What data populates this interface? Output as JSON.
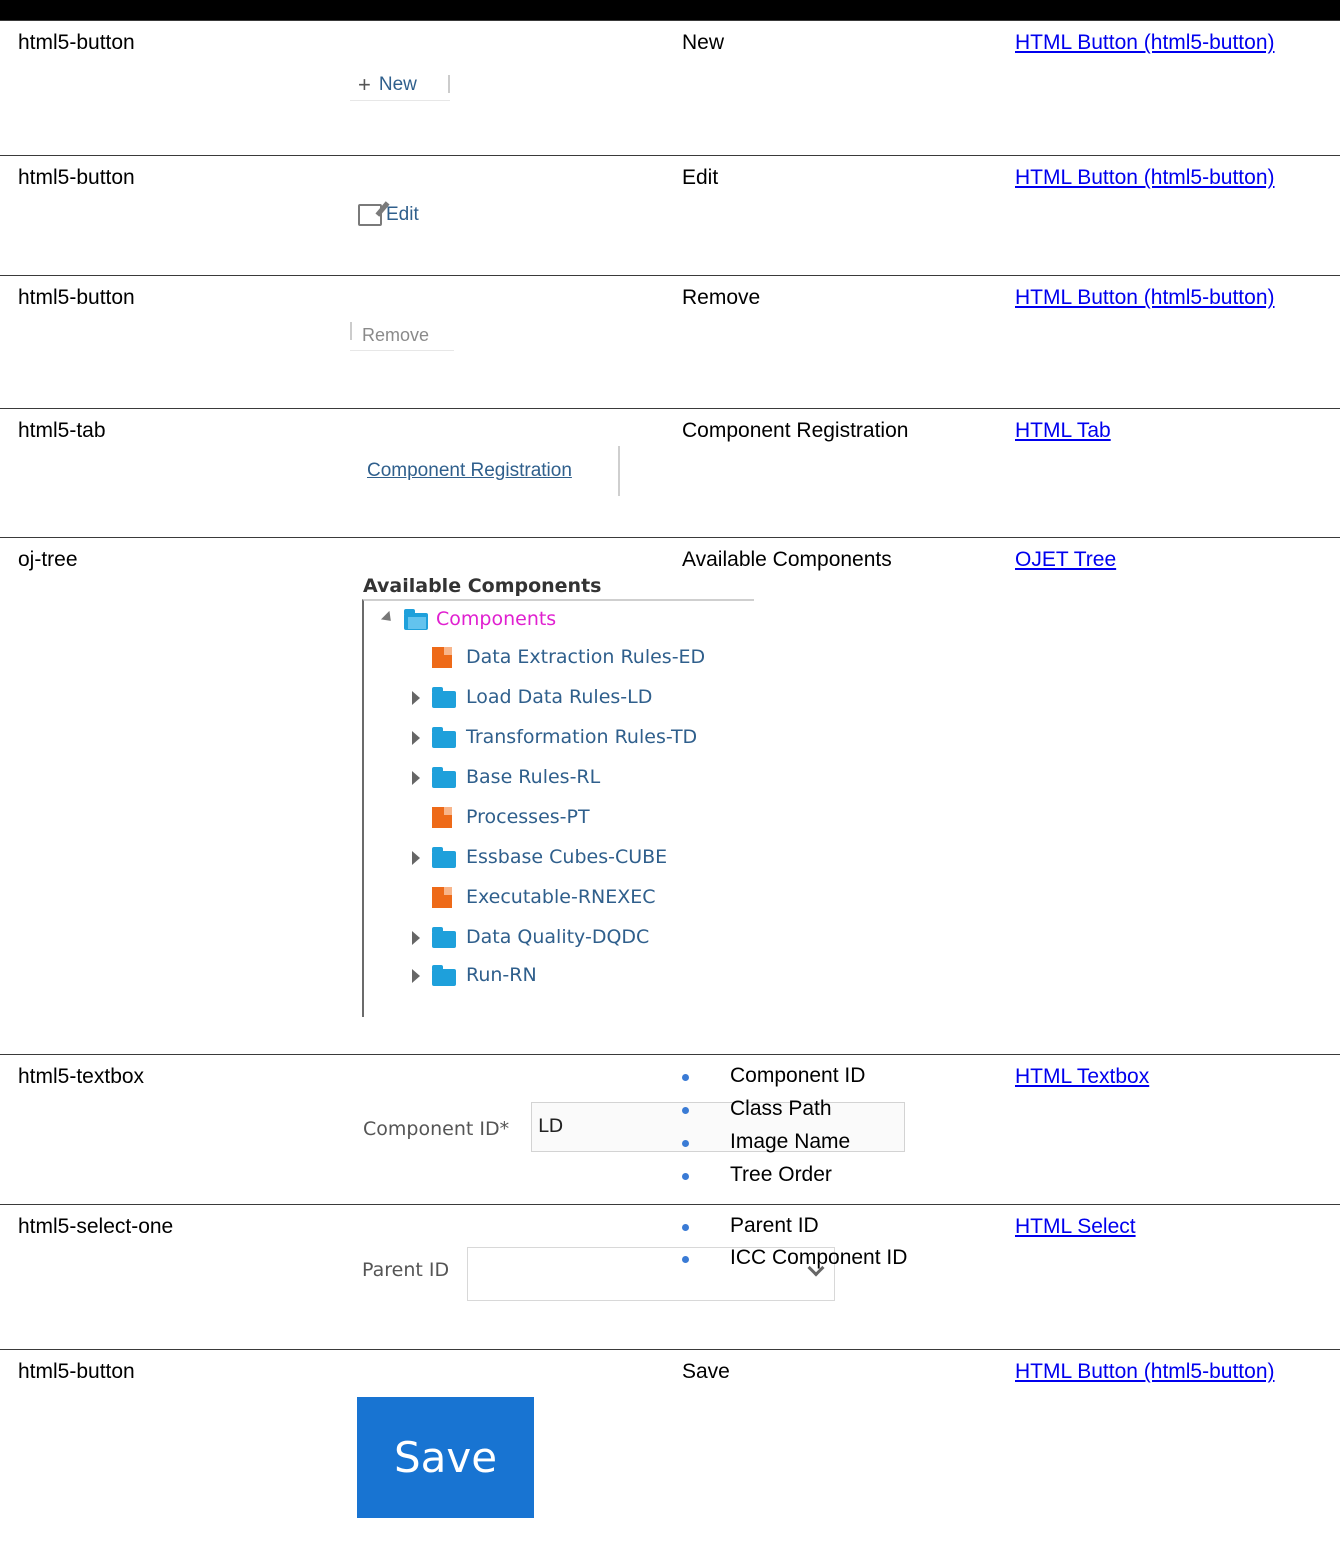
{
  "rows": [
    {
      "type": "html5-button",
      "description": "New",
      "link": "HTML Button (html5-button)"
    },
    {
      "type": "html5-button",
      "description": "Edit",
      "link": "HTML Button (html5-button)"
    },
    {
      "type": "html5-button",
      "description": "Remove",
      "link": "HTML Button (html5-button)"
    },
    {
      "type": "html5-tab",
      "description": "Component Registration",
      "link": "HTML Tab"
    },
    {
      "type": "oj-tree",
      "description": "Available Components",
      "link": "OJET Tree"
    },
    {
      "type": "html5-textbox",
      "description_items": [
        "Component ID",
        "Class Path",
        "Image Name",
        "Tree Order"
      ],
      "link": "HTML Textbox"
    },
    {
      "type": "html5-select-one",
      "description_items": [
        "Parent ID",
        "ICC Component ID"
      ],
      "link": "HTML Select"
    },
    {
      "type": "html5-button",
      "description": "Save",
      "link": "HTML Button (html5-button)"
    }
  ],
  "shots": {
    "new_label": "New",
    "edit_label": "Edit",
    "remove_label": "Remove",
    "tab_label": "Component Registration",
    "tree": {
      "title": "Available Components",
      "root": "Components",
      "items": [
        {
          "label": "Data Extraction Rules-ED",
          "kind": "doc"
        },
        {
          "label": "Load Data Rules-LD",
          "kind": "folder"
        },
        {
          "label": "Transformation Rules-TD",
          "kind": "folder"
        },
        {
          "label": "Base Rules-RL",
          "kind": "folder"
        },
        {
          "label": "Processes-PT",
          "kind": "doc"
        },
        {
          "label": "Essbase Cubes-CUBE",
          "kind": "folder"
        },
        {
          "label": "Executable-RNEXEC",
          "kind": "doc"
        },
        {
          "label": "Data Quality-DQDC",
          "kind": "folder"
        },
        {
          "label": "Run-RN",
          "kind": "folder"
        }
      ]
    },
    "textbox": {
      "label": "Component ID*",
      "value": "LD"
    },
    "select": {
      "label": "Parent ID",
      "value": ""
    },
    "save_label": "Save"
  },
  "colors": {
    "link": "#0000ee",
    "tree_text": "#2f5f8c",
    "tree_root": "#e020d0",
    "folder": "#1ea0db",
    "doc": "#ee6a18",
    "save_button": "#1874d2",
    "bullet": "#3a7bd5"
  }
}
